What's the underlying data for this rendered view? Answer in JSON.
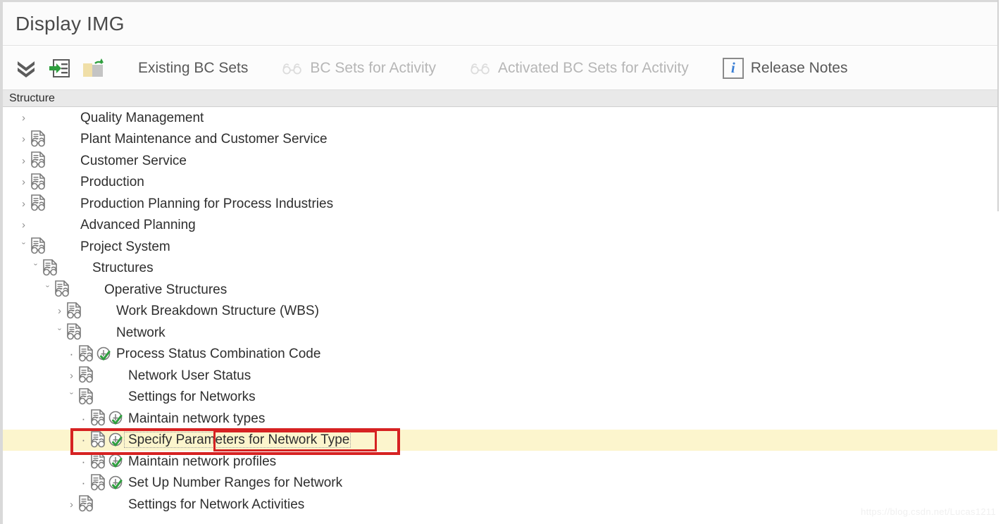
{
  "window": {
    "title": "Display IMG"
  },
  "toolbar": {
    "icons": [
      {
        "name": "expand-all-icon",
        "title": "Expand All"
      },
      {
        "name": "jump-to-icon",
        "title": "Jump To"
      },
      {
        "name": "cabinet-refresh-icon",
        "title": "Refresh"
      }
    ],
    "buttons": [
      {
        "label": "Existing BC Sets",
        "icon": "none",
        "disabled": false
      },
      {
        "label": "BC Sets for Activity",
        "icon": "glasses-icon",
        "disabled": true
      },
      {
        "label": "Activated BC Sets for Activity",
        "icon": "glasses-icon",
        "disabled": true
      },
      {
        "label": "Release Notes",
        "icon": "info-icon",
        "disabled": false
      }
    ],
    "release_notes_glyph": "i"
  },
  "structure_header": {
    "label": "Structure"
  },
  "tree": {
    "rows": [
      {
        "label": "Quality Management",
        "indent": 0,
        "twisty": "collapsed",
        "doc": false,
        "clock": false
      },
      {
        "label": "Plant Maintenance and Customer Service",
        "indent": 0,
        "twisty": "collapsed",
        "doc": true,
        "clock": false
      },
      {
        "label": "Customer Service",
        "indent": 0,
        "twisty": "collapsed",
        "doc": true,
        "clock": false
      },
      {
        "label": "Production",
        "indent": 0,
        "twisty": "collapsed",
        "doc": true,
        "clock": false
      },
      {
        "label": "Production Planning for Process Industries",
        "indent": 0,
        "twisty": "collapsed",
        "doc": true,
        "clock": false
      },
      {
        "label": "Advanced Planning",
        "indent": 0,
        "twisty": "collapsed",
        "doc": false,
        "clock": false
      },
      {
        "label": "Project System",
        "indent": 0,
        "twisty": "expanded",
        "doc": true,
        "clock": false
      },
      {
        "label": "Structures",
        "indent": 1,
        "twisty": "expanded",
        "doc": true,
        "clock": false
      },
      {
        "label": "Operative Structures",
        "indent": 2,
        "twisty": "expanded",
        "doc": true,
        "clock": false
      },
      {
        "label": "Work Breakdown Structure (WBS)",
        "indent": 3,
        "twisty": "collapsed",
        "doc": true,
        "clock": false
      },
      {
        "label": "Network",
        "indent": 3,
        "twisty": "expanded",
        "doc": true,
        "clock": false
      },
      {
        "label": "Process Status Combination Code",
        "indent": 4,
        "twisty": "leaf",
        "doc": true,
        "clock": true
      },
      {
        "label": "Network User Status",
        "indent": 4,
        "twisty": "collapsed",
        "doc": true,
        "clock": false
      },
      {
        "label": "Settings for Networks",
        "indent": 4,
        "twisty": "expanded",
        "doc": true,
        "clock": false
      },
      {
        "label": "Maintain network types",
        "indent": 5,
        "twisty": "leaf",
        "doc": true,
        "clock": true
      },
      {
        "label": "Specify Parameters for Network Type",
        "indent": 5,
        "twisty": "leaf",
        "doc": true,
        "clock": true,
        "selected": true
      },
      {
        "label": "Maintain network profiles",
        "indent": 5,
        "twisty": "leaf",
        "doc": true,
        "clock": true
      },
      {
        "label": "Set Up Number Ranges for Network",
        "indent": 5,
        "twisty": "leaf",
        "doc": true,
        "clock": true
      },
      {
        "label": "Settings for Network Activities",
        "indent": 4,
        "twisty": "collapsed",
        "doc": true,
        "clock": false
      }
    ],
    "twisty_glyphs": {
      "collapsed": "›",
      "expanded": "ˇ",
      "leaf": "·"
    }
  },
  "annotations": [
    {
      "name": "highlight-rect-row",
      "color": "#d62222"
    },
    {
      "name": "highlight-rect-text",
      "color": "#d62222"
    }
  ],
  "watermark": {
    "text": "https://blog.csdn.net/Lucas1211"
  },
  "colors": {
    "selection_background": "#fcf5cd",
    "annotation_red": "#d62222",
    "accent_green": "#2e9e3e",
    "info_blue": "#3b7fd4",
    "header_gray": "#e9e9e9"
  }
}
